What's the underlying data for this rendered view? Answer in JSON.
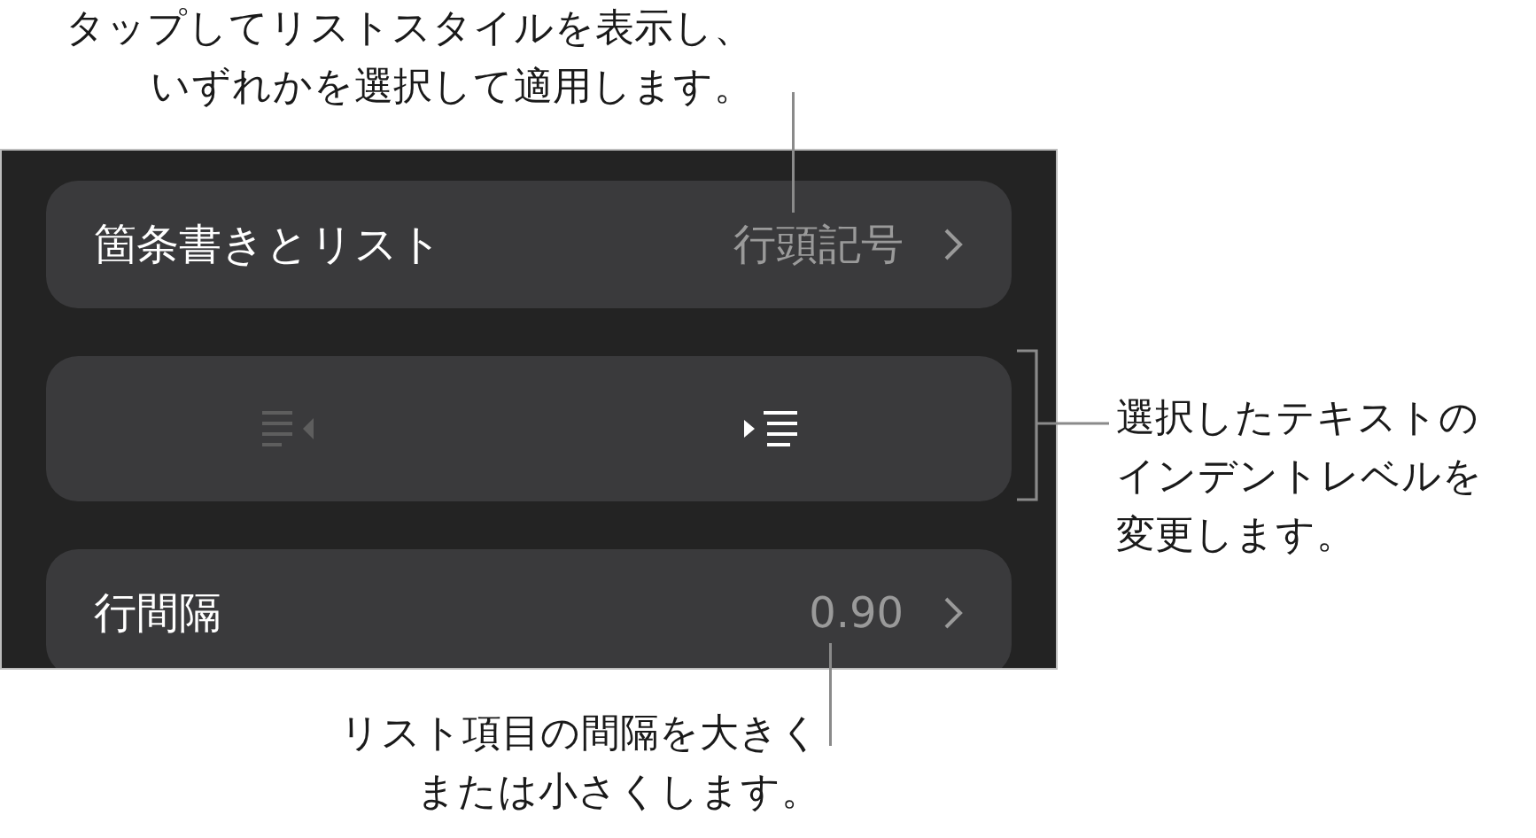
{
  "callouts": [
    {
      "lines": [
        "タップしてリストスタイルを表示し、",
        "いずれかを選択して適用します。"
      ]
    },
    {
      "lines": [
        "選択したテキストの",
        "インデントレベルを",
        "変更します。"
      ]
    },
    {
      "lines": [
        "リスト項目の間隔を大きく",
        "または小さくします。"
      ]
    }
  ],
  "panel": {
    "rows": [
      {
        "kind": "disclosure",
        "label": "箇条書きとリスト",
        "value": "行頭記号"
      },
      {
        "kind": "indent",
        "buttons": [
          {
            "kind": "outdent",
            "disabled": true
          },
          {
            "kind": "indent",
            "disabled": false
          }
        ]
      },
      {
        "kind": "disclosure",
        "label": "行間隔",
        "value": "0.90"
      }
    ]
  }
}
